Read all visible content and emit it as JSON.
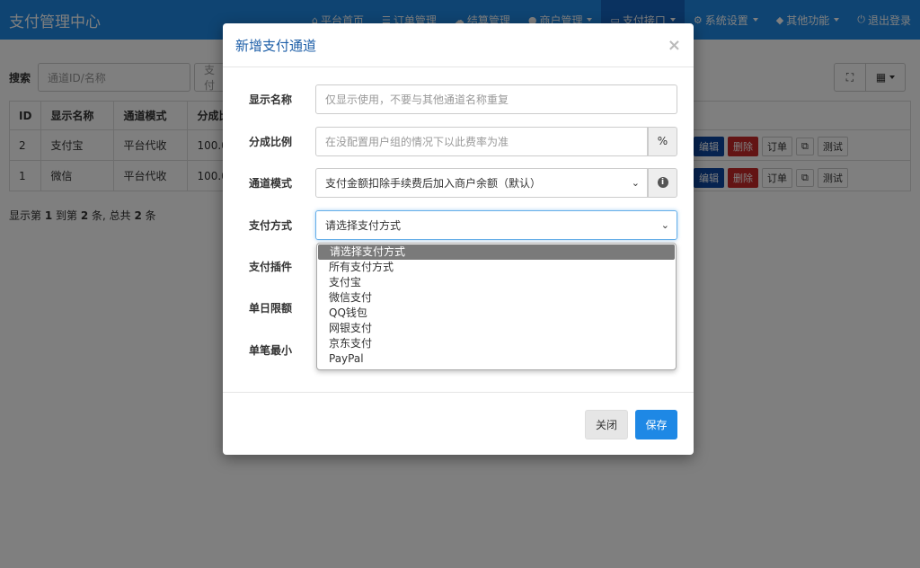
{
  "app": {
    "brand": "支付管理中心"
  },
  "nav": [
    {
      "icon": "home-icon",
      "glyph": "⌂",
      "label": "平台首页",
      "caret": false,
      "active": false
    },
    {
      "icon": "list-icon",
      "glyph": "☰",
      "label": "订单管理",
      "caret": false,
      "active": false
    },
    {
      "icon": "cloud-icon",
      "glyph": "☁",
      "label": "结算管理",
      "caret": false,
      "active": false
    },
    {
      "icon": "user-icon",
      "glyph": "●",
      "label": "商户管理",
      "caret": true,
      "active": false
    },
    {
      "icon": "card-icon",
      "glyph": "▭",
      "label": "支付接口",
      "caret": true,
      "active": true
    },
    {
      "icon": "gear-icon",
      "glyph": "⚙",
      "label": "系统设置",
      "caret": true,
      "active": false
    },
    {
      "icon": "cube-icon",
      "glyph": "◆",
      "label": "其他功能",
      "caret": true,
      "active": false
    },
    {
      "icon": "power-icon",
      "glyph": "⏻",
      "label": "退出登录",
      "caret": false,
      "active": false
    }
  ],
  "toolbar": {
    "search_label": "搜索",
    "search_placeholder": "通道ID/名称",
    "second_placeholder": "支付",
    "fullscreen_glyph": "⛶",
    "columns_glyph": "▦"
  },
  "table": {
    "headers": [
      "ID",
      "显示名称",
      "通道模式",
      "分成比"
    ],
    "rows": [
      {
        "id": "2",
        "name": "支付宝",
        "mode": "平台代收",
        "ratio": "100.0"
      },
      {
        "id": "1",
        "name": "微信",
        "mode": "平台代收",
        "ratio": "100.0"
      }
    ],
    "ops": {
      "edit": "编辑",
      "del": "删除",
      "order": "订单",
      "copy": "⧉",
      "test": "测试"
    }
  },
  "pageinfo": {
    "prefix": "显示第 ",
    "from": "1",
    "mid1": " 到第 ",
    "to": "2",
    "mid2": " 条, 总共 ",
    "total": "2",
    "suffix": " 条"
  },
  "modal": {
    "title": "新增支付通道",
    "close_glyph": "×",
    "fields": {
      "name_label": "显示名称",
      "name_placeholder": "仅显示使用，不要与其他通道名称重复",
      "ratio_label": "分成比例",
      "ratio_placeholder": "在没配置用户组的情况下以此费率为准",
      "ratio_addon": "%",
      "mode_label": "通道模式",
      "mode_value": "支付金额扣除手续费后加入商户余额（默认）",
      "paytype_label": "支付方式",
      "paytype_value": "请选择支付方式",
      "plugin_label": "支付插件",
      "daylimit_label": "单日限额",
      "minimum_label": "单笔最小"
    },
    "paytype_options": [
      "请选择支付方式",
      "所有支付方式",
      "支付宝",
      "微信支付",
      "QQ钱包",
      "网银支付",
      "京东支付",
      "PayPal"
    ],
    "selected_index": 0,
    "buttons": {
      "close": "关闭",
      "save": "保存"
    }
  }
}
